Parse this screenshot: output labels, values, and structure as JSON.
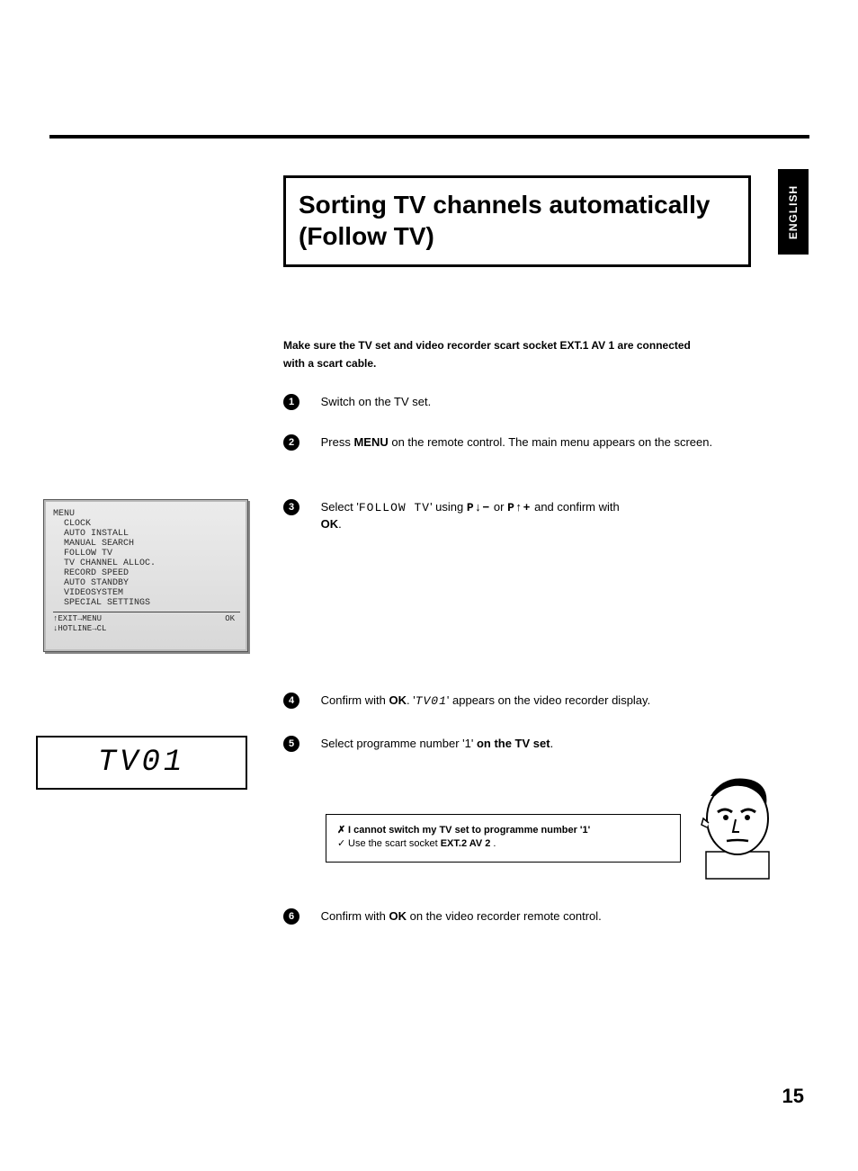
{
  "language_tab": "ENGLISH",
  "title": "Sorting TV channels automatically (Follow TV)",
  "intro": {
    "line1_prefix": "Make sure the TV set and video recorder scart socket ",
    "ext1": "EXT.1 AV 1",
    "line1_suffix": " ",
    "connected": "are connected",
    "line2": "with a scart cable",
    "period": "."
  },
  "steps": {
    "s1": {
      "num": "1",
      "text": "Switch on the TV set."
    },
    "s2": {
      "num": "2",
      "pre": "Press ",
      "menu": "MENU",
      "post": " on the remote control. The main menu appears on the screen."
    },
    "s3": {
      "num": "3",
      "pre": "Select '",
      "follow": "FOLLOW TV",
      "mid": "' using ",
      "pdn": "P↓−",
      "or": " or ",
      "pup": "P↑+",
      "post": " and confirm with ",
      "ok": "OK",
      "period": "."
    },
    "s4": {
      "num": "4",
      "pre": "Confirm with ",
      "ok": "OK",
      "post": ". '",
      "tv01": "TV01",
      "end": "' appears on the video recorder display."
    },
    "s5": {
      "num": "5",
      "pre": "Select programme number '1' ",
      "onset": "on the TV set",
      "post": "."
    },
    "s6": {
      "num": "6",
      "pre": "Confirm with ",
      "ok": "OK",
      "post": " on the video recorder remote control."
    }
  },
  "menu_screen": {
    "header": "MENU",
    "items": [
      "  CLOCK",
      "  AUTO INSTALL",
      "  MANUAL SEARCH",
      "  FOLLOW TV",
      "  TV CHANNEL ALLOC.",
      "  RECORD SPEED",
      "  AUTO STANDBY",
      "  VIDEOSYSTEM",
      "  SPECIAL SETTINGS"
    ],
    "footer_left1": "↑EXIT→MENU",
    "footer_left2": "↓HOTLINE→CL",
    "footer_right": "OK"
  },
  "tv01_display": "TV01",
  "problem": {
    "x": "✗",
    "q": "I cannot switch my TV set to programme number '1'",
    "chk": "✓",
    "a_pre": "Use the scart socket ",
    "ext2": "EXT.2 AV 2",
    "a_post": " ."
  },
  "page_number": "15"
}
